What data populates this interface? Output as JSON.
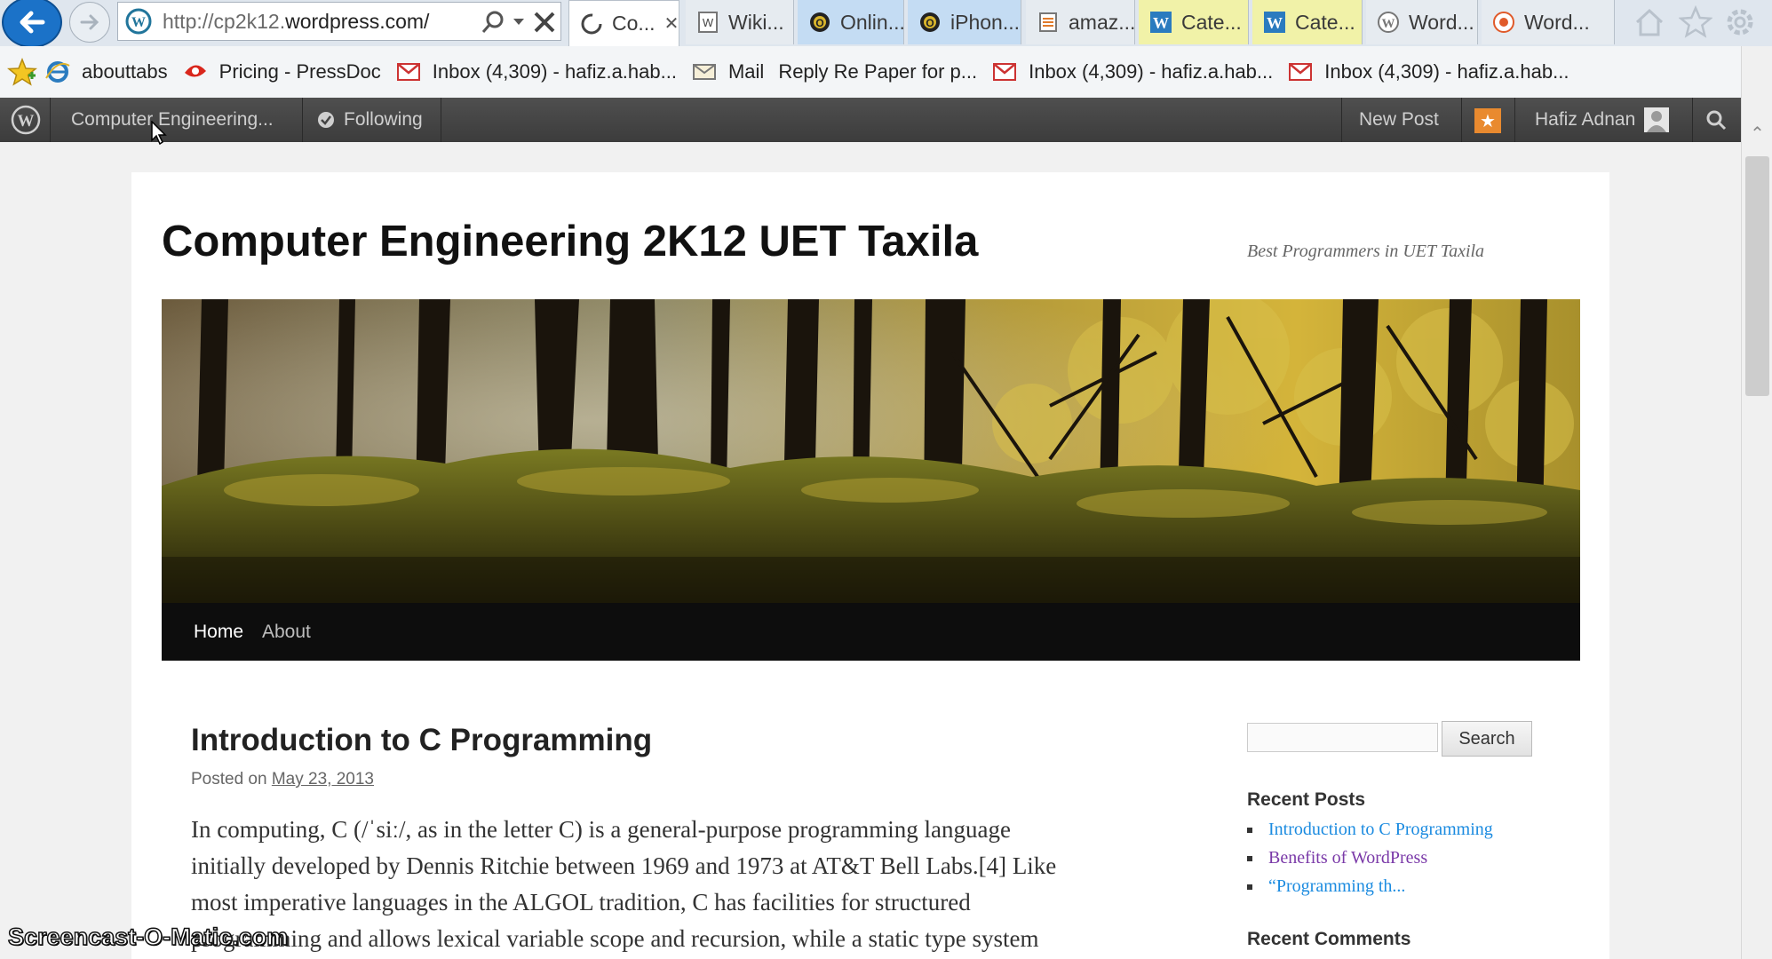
{
  "browser": {
    "address": {
      "host_prefix": "http://cp2k12.",
      "host_main": "wordpress.com/"
    },
    "tabs": [
      {
        "label": "Co...",
        "style": "active",
        "icon": "loading-spinner-icon"
      },
      {
        "label": "Wiki...",
        "style": "plain",
        "icon": "wiki-icon"
      },
      {
        "label": "Onlin...",
        "style": "blue",
        "icon": "circle-badge-icon"
      },
      {
        "label": "iPhon...",
        "style": "blue",
        "icon": "circle-badge-icon"
      },
      {
        "label": "amaz...",
        "style": "plain",
        "icon": "stack-icon"
      },
      {
        "label": "Cate...",
        "style": "yellow",
        "icon": "wordpress-icon"
      },
      {
        "label": "Cate...",
        "style": "yellow",
        "icon": "wordpress-icon"
      },
      {
        "label": "Word...",
        "style": "plain",
        "icon": "wordpress-icon"
      },
      {
        "label": "Word...",
        "style": "plain",
        "icon": "target-icon"
      }
    ],
    "bookmarks": [
      {
        "label": "abouttabs",
        "icon": "ie-icon"
      },
      {
        "label": "Pricing - PressDoc",
        "icon": "pressdoc-icon"
      },
      {
        "label": "Inbox (4,309) - hafiz.a.hab...",
        "icon": "gmail-icon"
      },
      {
        "label": "Mail",
        "icon": "mail-icon"
      },
      {
        "label": "Reply Re Paper for p...",
        "icon": ""
      },
      {
        "label": "Inbox (4,309) - hafiz.a.hab...",
        "icon": "gmail-icon"
      },
      {
        "label": "Inbox (4,309) - hafiz.a.hab...",
        "icon": "gmail-icon"
      }
    ]
  },
  "adminbar": {
    "site": "Computer Engineering...",
    "following": "Following",
    "new_post": "New Post",
    "user": "Hafiz Adnan"
  },
  "site": {
    "title": "Computer Engineering 2K12 UET Taxila",
    "tagline": "Best Programmers in UET Taxila",
    "nav": [
      "Home",
      "About"
    ]
  },
  "post": {
    "title": "Introduction to C Programming",
    "posted_on": "Posted on",
    "date": "May 23, 2013",
    "lines": [
      "In computing, C (/ˈsiː/, as in the letter C) is a general-purpose programming language",
      "initially developed by Dennis Ritchie between 1969 and 1973 at AT&T Bell Labs.[4] Like",
      "most imperative languages in the ALGOL tradition, C has facilities for structured",
      "programming and allows lexical variable scope and recursion, while a static type system"
    ]
  },
  "sidebar": {
    "search_placeholder": "",
    "search_button": "Search",
    "recent_posts_title": "Recent Posts",
    "recent_posts": [
      {
        "label": "Introduction to C Programming",
        "visited": false
      },
      {
        "label": "Benefits of WordPress",
        "visited": true
      },
      {
        "label": "“Programming th...",
        "visited": false
      }
    ],
    "recent_comments_title": "Recent Comments"
  },
  "watermark": "Screencast-O-Matic.com",
  "colors": {
    "admin_bar": "#464646",
    "link": "#1b8be0",
    "visited_link": "#7a39a8",
    "notification": "#e98a2f"
  }
}
